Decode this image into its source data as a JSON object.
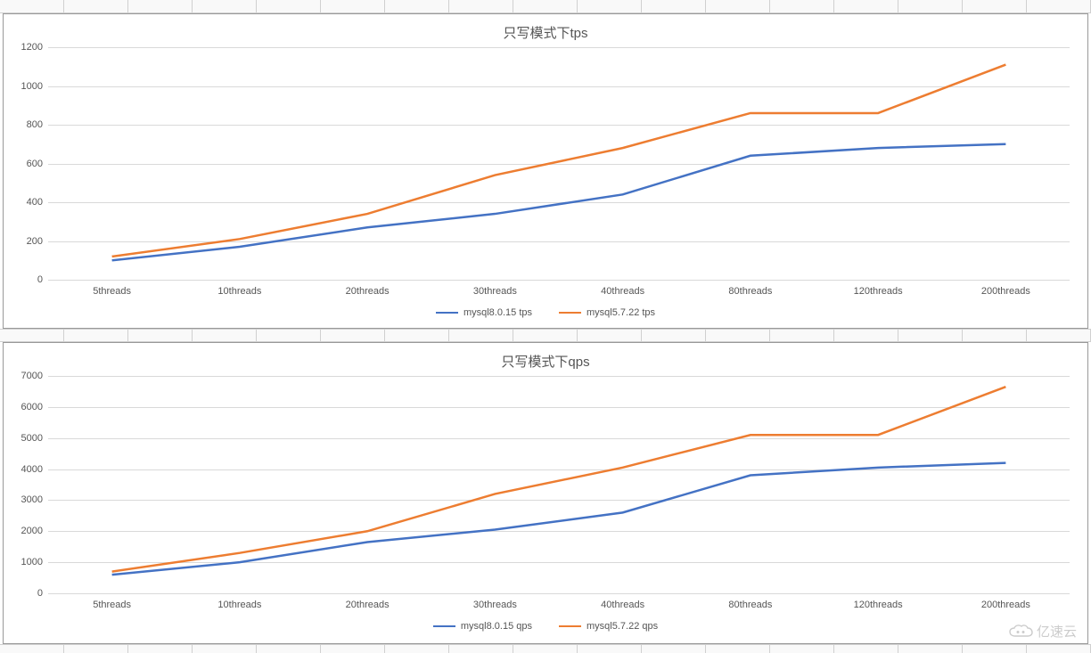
{
  "chart_data": [
    {
      "id": "tps",
      "type": "line",
      "title": "只写模式下tps",
      "categories": [
        "5threads",
        "10threads",
        "20threads",
        "30threads",
        "40threads",
        "80threads",
        "120threads",
        "200threads"
      ],
      "series": [
        {
          "name": "mysql8.0.15 tps",
          "color": "#4472C4",
          "values": [
            100,
            170,
            270,
            340,
            440,
            640,
            680,
            700
          ]
        },
        {
          "name": "mysql5.7.22 tps",
          "color": "#ED7D31",
          "values": [
            120,
            210,
            340,
            540,
            680,
            860,
            860,
            1110
          ]
        }
      ],
      "ylim": [
        0,
        1200
      ],
      "ystep": 200,
      "yticks": [
        0,
        200,
        400,
        600,
        800,
        1000,
        1200
      ]
    },
    {
      "id": "qps",
      "type": "line",
      "title": "只写模式下qps",
      "categories": [
        "5threads",
        "10threads",
        "20threads",
        "30threads",
        "40threads",
        "80threads",
        "120threads",
        "200threads"
      ],
      "series": [
        {
          "name": "mysql8.0.15 qps",
          "color": "#4472C4",
          "values": [
            600,
            1000,
            1650,
            2050,
            2600,
            3800,
            4050,
            4200
          ]
        },
        {
          "name": "mysql5.7.22 qps",
          "color": "#ED7D31",
          "values": [
            700,
            1300,
            2000,
            3200,
            4050,
            5100,
            5100,
            6650
          ]
        }
      ],
      "ylim": [
        0,
        7000
      ],
      "ystep": 1000,
      "yticks": [
        0,
        1000,
        2000,
        3000,
        4000,
        5000,
        6000,
        7000
      ]
    }
  ],
  "watermark": "亿速云"
}
